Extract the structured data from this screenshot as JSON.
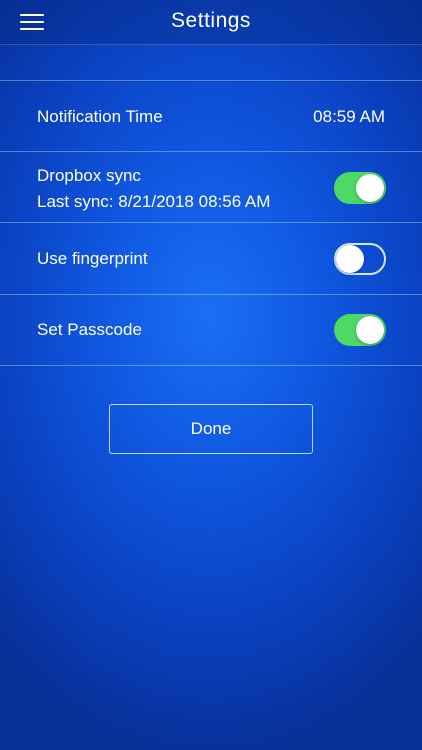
{
  "header": {
    "title": "Settings",
    "menu_icon": "hamburger-menu-icon"
  },
  "settings": {
    "notification_time": {
      "label": "Notification Time",
      "value": "08:59 AM"
    },
    "dropbox_sync": {
      "label": "Dropbox sync",
      "last_sync": "Last sync: 8/21/2018 08:56 AM",
      "enabled": true
    },
    "fingerprint": {
      "label": "Use fingerprint",
      "enabled": false
    },
    "passcode": {
      "label": "Set Passcode",
      "enabled": true
    }
  },
  "done_label": "Done",
  "colors": {
    "toggle_on": "#4cd964",
    "background": "#0f55de"
  }
}
